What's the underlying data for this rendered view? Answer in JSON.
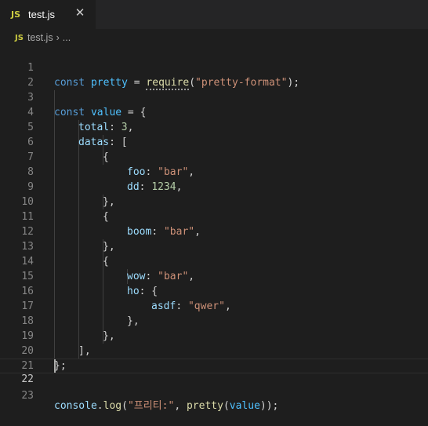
{
  "tab": {
    "badge": "JS",
    "label": "test.js",
    "close_glyph": "✕"
  },
  "breadcrumb": {
    "badge": "JS",
    "file": "test.js",
    "separator": "›",
    "rest": "..."
  },
  "editor": {
    "line_numbers": [
      "1",
      "2",
      "3",
      "4",
      "5",
      "6",
      "7",
      "8",
      "9",
      "10",
      "11",
      "12",
      "13",
      "14",
      "15",
      "16",
      "17",
      "18",
      "19",
      "20",
      "21",
      "22",
      "23"
    ],
    "tokens": {
      "l1_const": "const",
      "l1_pretty": "pretty",
      "l1_eq": " = ",
      "l1_require": "require",
      "l1_open": "(",
      "l1_str": "\"pretty-format\"",
      "l1_close": ");",
      "l3_const": "const",
      "l3_value": "value",
      "l3_rest": " = {",
      "l4_total": "total",
      "l4_colon": ": ",
      "l4_num": "3",
      "l4_comma": ",",
      "l5_datas": "datas",
      "l5_rest": ": [",
      "l6_brace": "{",
      "l7_foo": "foo",
      "l7_colon": ": ",
      "l7_str": "\"bar\"",
      "l7_comma": ",",
      "l8_dd": "dd",
      "l8_colon": ": ",
      "l8_num": "1234",
      "l8_comma": ",",
      "l9_close": "},",
      "l10_brace": "{",
      "l11_boom": "boom",
      "l11_colon": ": ",
      "l11_str": "\"bar\"",
      "l11_comma": ",",
      "l12_close": "},",
      "l13_brace": "{",
      "l14_wow": "wow",
      "l14_colon": ": ",
      "l14_str": "\"bar\"",
      "l14_comma": ",",
      "l15_ho": "ho",
      "l15_rest": ": {",
      "l16_asdf": "asdf",
      "l16_colon": ": ",
      "l16_str": "\"qwer\"",
      "l16_comma": ",",
      "l17_close": "},",
      "l18_close": "},",
      "l19_close": "],",
      "l20_close": "};",
      "l22_console": "console",
      "l22_dot": ".",
      "l22_log": "log",
      "l22_open": "(",
      "l22_str": "\"프리티:\"",
      "l22_mid": ", ",
      "l22_pretty": "pretty",
      "l22_open2": "(",
      "l22_value": "value",
      "l22_close": "));"
    }
  },
  "colors": {
    "background": "#1e1e1e",
    "keyword": "#569cd6",
    "variable": "#9cdcfe",
    "constant": "#4fc1ff",
    "function": "#dcdcaa",
    "string": "#ce9178",
    "number": "#b5cea8"
  }
}
